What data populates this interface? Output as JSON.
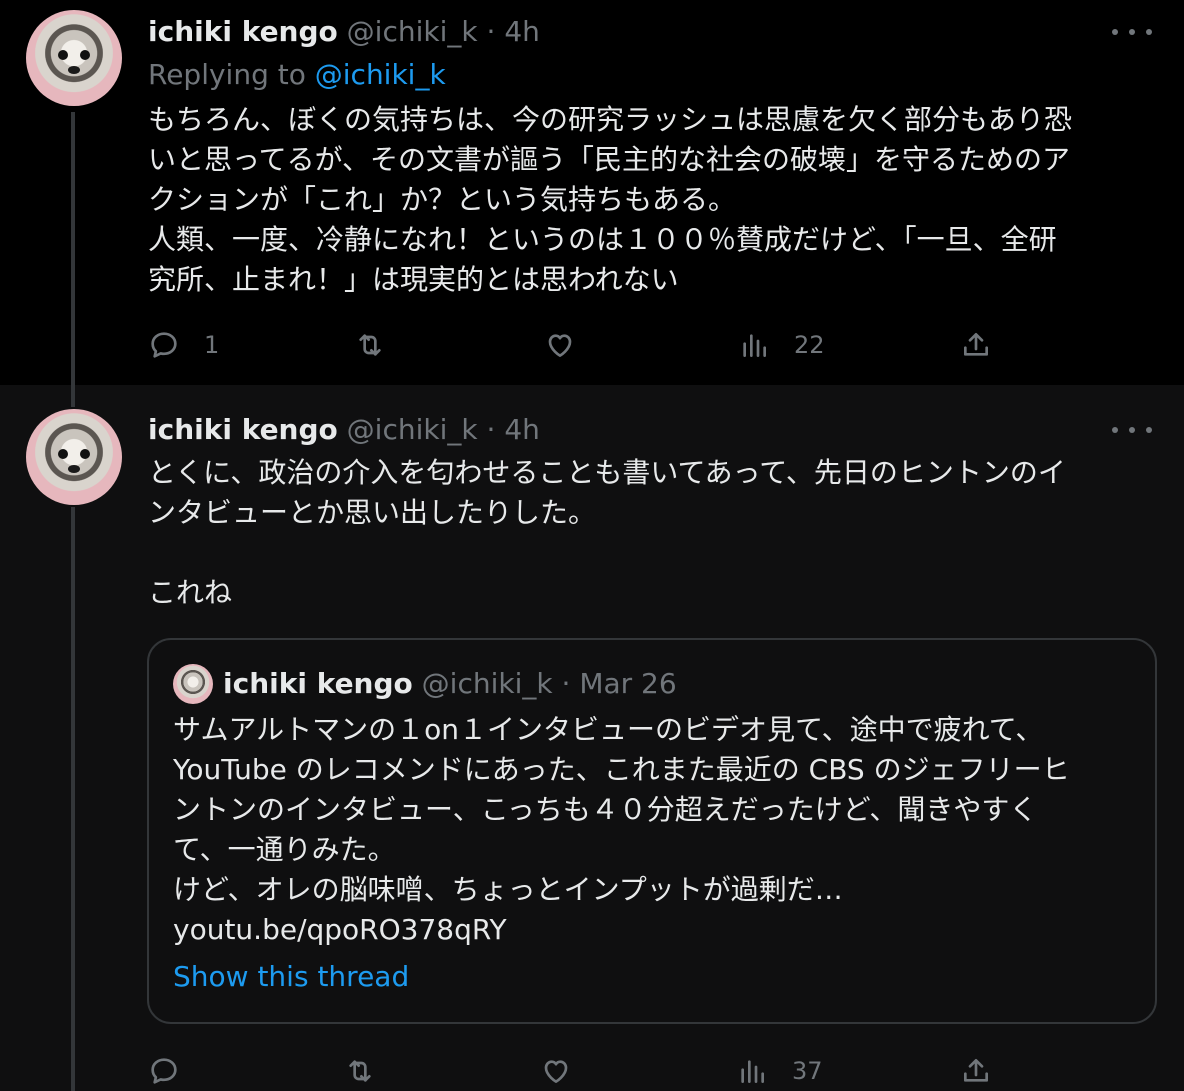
{
  "tweet1": {
    "display_name": "ichiki kengo",
    "handle": "@ichiki_k",
    "dot": "·",
    "time": "4h",
    "replying_prefix": "Replying to ",
    "replying_handle": "@ichiki_k",
    "text": "もちろん、ぼくの気持ちは、今の研究ラッシュは思慮を欠く部分もあり恐\nいと思ってるが、その文書が謳う「民主的な社会の破壊」を守るためのア\nクションが「これ」か？という気持ちもある。\n人類、一度、冷静になれ！というのは１００％賛成だけど、「一旦、全研\n究所、止まれ！」は現実的とは思われない",
    "actions": {
      "reply_count": "1",
      "retweet_count": "",
      "like_count": "",
      "views_count": "22"
    }
  },
  "tweet2": {
    "display_name": "ichiki kengo",
    "handle": "@ichiki_k",
    "dot": "·",
    "time": "4h",
    "text": "とくに、政治の介入を匂わせることも書いてあって、先日のヒントンのイ\nンタビューとか思い出したりした。\n\nこれね",
    "quote": {
      "display_name": "ichiki kengo",
      "handle": "@ichiki_k",
      "dot": "·",
      "date": "Mar 26",
      "text": "サムアルトマンの１on１インタビューのビデオ見て、途中で疲れて、\nYouTube のレコメンドにあった、これまた最近の CBS のジェフリーヒ\nントンのインタビュー、こっちも４０分超えだったけど、聞きやすく\nて、一通りみた。\nけど、オレの脳味噌、ちょっとインプットが過剰だ…\nyoutu.be/qpoRO378qRY",
      "show_thread": "Show this thread"
    },
    "actions": {
      "reply_count": "",
      "retweet_count": "",
      "like_count": "",
      "views_count": "37"
    }
  },
  "icons": {
    "reply": "reply-icon",
    "retweet": "retweet-icon",
    "like": "heart-icon",
    "views": "views-icon",
    "share": "share-icon",
    "more": "more-icon"
  },
  "colors": {
    "background": "#000000",
    "secondary_background": "#0f0f10",
    "text": "#e7e9ea",
    "muted": "#71767b",
    "link": "#1d9bf0",
    "border": "#333639"
  }
}
